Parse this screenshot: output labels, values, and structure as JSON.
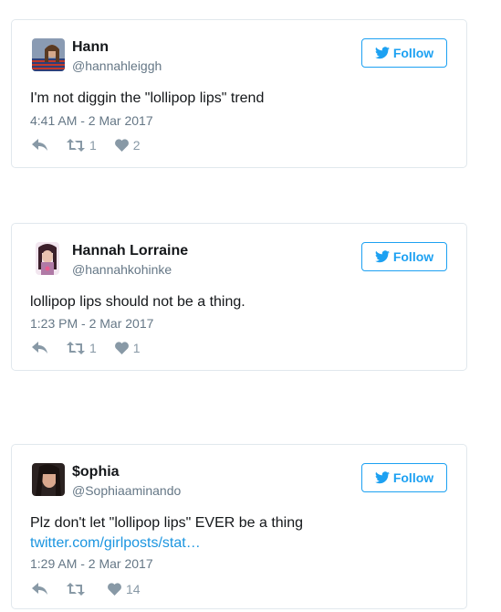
{
  "follow_label": "Follow",
  "accent_color": "#1da1f2",
  "tweets": [
    {
      "name": "Hann",
      "handle": "@hannahleiggh",
      "text": "I'm not diggin the \"lollipop lips\" trend",
      "link": "",
      "time": "4:41 AM - 2 Mar 2017",
      "retweets": "1",
      "likes": "2"
    },
    {
      "name": "Hannah Lorraine",
      "handle": "@hannahkohinke",
      "text": "lollipop lips should not be a thing.",
      "link": "",
      "time": "1:23 PM - 2 Mar 2017",
      "retweets": "1",
      "likes": "1"
    },
    {
      "name": "$ophia",
      "handle": "@Sophiaaminando",
      "text": "Plz don't let \"lollipop lips\" EVER be a thing",
      "link": "twitter.com/girlposts/stat…",
      "time": "1:29 AM - 2 Mar 2017",
      "retweets": "",
      "likes": "14"
    }
  ]
}
